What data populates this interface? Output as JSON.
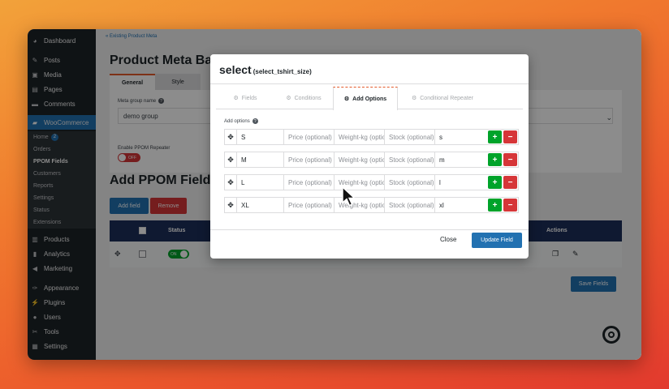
{
  "sidebar": {
    "items": [
      {
        "label": "Dashboard",
        "icon": "dashboard-icon"
      },
      {
        "label": "Posts",
        "icon": "pin-icon"
      },
      {
        "label": "Media",
        "icon": "media-icon"
      },
      {
        "label": "Pages",
        "icon": "pages-icon"
      },
      {
        "label": "Comments",
        "icon": "comments-icon"
      },
      {
        "label": "WooCommerce",
        "icon": "woocommerce-icon"
      }
    ],
    "woo_sub": [
      {
        "label": "Home",
        "badge": "2"
      },
      {
        "label": "Orders"
      },
      {
        "label": "PPOM Fields"
      },
      {
        "label": "Customers"
      },
      {
        "label": "Reports"
      },
      {
        "label": "Settings"
      },
      {
        "label": "Status"
      },
      {
        "label": "Extensions"
      }
    ],
    "items_lower": [
      {
        "label": "Products",
        "icon": "products-icon"
      },
      {
        "label": "Analytics",
        "icon": "analytics-icon"
      },
      {
        "label": "Marketing",
        "icon": "marketing-icon"
      },
      {
        "label": "Appearance",
        "icon": "appearance-icon"
      },
      {
        "label": "Plugins",
        "icon": "plugins-icon"
      },
      {
        "label": "Users",
        "icon": "users-icon"
      },
      {
        "label": "Tools",
        "icon": "tools-icon"
      },
      {
        "label": "Settings",
        "icon": "settings-icon"
      }
    ]
  },
  "main": {
    "breadcrumb": "« Existing Product Meta",
    "title": "Product Meta Bas",
    "tabs": [
      "General",
      "Style"
    ],
    "meta_group_label": "Meta group name",
    "meta_group_value": "demo group",
    "repeater_label": "Enable PPOM Repeater",
    "repeater_toggle": "OFF",
    "section_title": "Add PPOM Fields",
    "add_field": "Add field",
    "remove": "Remove",
    "col_status": "Status",
    "col_actions": "Actions",
    "row_toggle": "ON",
    "save_fields": "Save Fields"
  },
  "modal": {
    "title": "select",
    "subtitle": "(select_tshirt_size)",
    "tabs": [
      "Fields",
      "Conditions",
      "Add Options",
      "Conditional Repeater"
    ],
    "options_label": "Add options",
    "placeholders": {
      "price": "Price (optional)",
      "weight": "Weight-kg (optional)",
      "stock": "Stock (optional)"
    },
    "options": [
      {
        "label": "S",
        "id": "s"
      },
      {
        "label": "M",
        "id": "m"
      },
      {
        "label": "L",
        "id": "l"
      },
      {
        "label": "XL",
        "id": "xl"
      }
    ],
    "close": "Close",
    "update": "Update Field"
  },
  "colors": {
    "accent": "#2271b1",
    "danger": "#d63638",
    "success": "#00a32a",
    "sidebar_bg": "#1d2327",
    "table_head": "#1d2f5a"
  }
}
